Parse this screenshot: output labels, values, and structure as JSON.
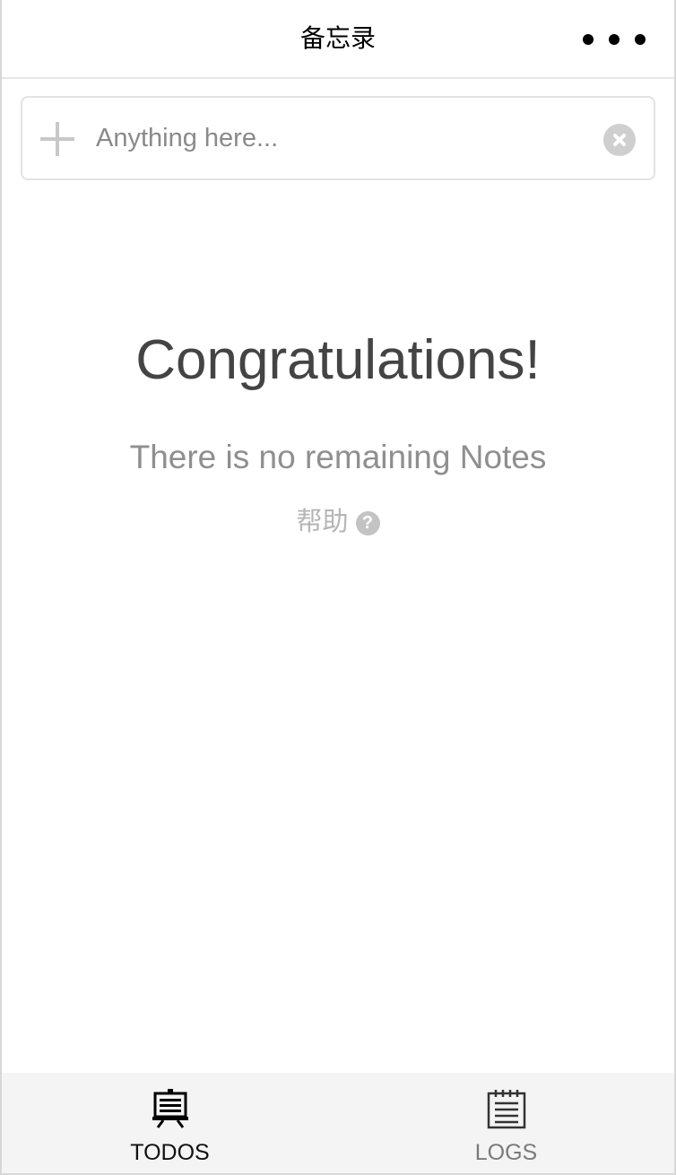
{
  "header": {
    "title": "备忘录",
    "more_icon": "more-dots-icon"
  },
  "input": {
    "placeholder": "Anything here...",
    "value": "",
    "add_icon": "plus-icon",
    "clear_icon": "clear-circle-icon"
  },
  "empty_state": {
    "title": "Congratulations!",
    "subtitle": "There is no remaining Notes",
    "help_label": "帮助",
    "help_icon": "question-circle-icon"
  },
  "tabbar": {
    "tabs": [
      {
        "label": "TODOS",
        "icon": "todo-board-icon",
        "active": true
      },
      {
        "label": "LOGS",
        "icon": "log-notepad-icon",
        "active": false
      }
    ]
  },
  "colors": {
    "accent_active": "#111111",
    "inactive": "#7a7a7a",
    "tabbar_bg": "#f4f4f4",
    "title_text": "#444444",
    "subtitle_text": "#8f8f8f"
  }
}
